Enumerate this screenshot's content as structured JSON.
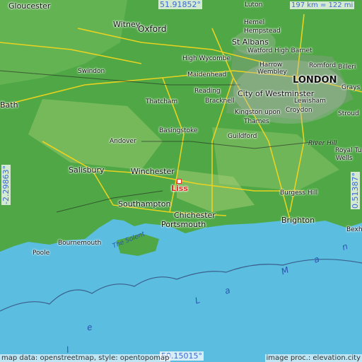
{
  "coordinates": {
    "north": "51.91852°",
    "south": "50.15015°",
    "west": "-2.29863°",
    "east": "0.51387°",
    "scale": "197 km = 122 mi"
  },
  "places": {
    "gloucester": "Gloucester",
    "luton": "Luton",
    "witney": "Witney",
    "oxford": "Oxford",
    "hemel": "Hemel",
    "hempstead": "Hempstead",
    "st_albans": "St Albans",
    "watford": "Watford",
    "high_barnet": "High Barnet",
    "high_wycombe": "High Wycombe",
    "harrow": "Harrow",
    "wembley": "Wembley",
    "romford": "Romford",
    "billericay": "Billeri",
    "maidenhead": "Maidenhead",
    "london": "LONDON",
    "swindon": "Swindon",
    "reading": "Reading",
    "city_westminster": "City of Westminster",
    "grays": "Grays",
    "bath": "Bath",
    "thatcham": "Thatcham",
    "bracknell": "Bracknell",
    "lewisham": "Lewisham",
    "croydon": "Croydon",
    "kingston": "Kingston upon",
    "thames": "Thames",
    "stroud": "Stroud",
    "basingstoke": "Basingstoke",
    "guildford": "Guildford",
    "andover": "Andover",
    "river_hill": "River Hill",
    "royal_tunbridge": "Royal Tu",
    "wells": "Wells",
    "salisbury": "Salisbury",
    "winchester": "Winchester",
    "liss": "Liss",
    "burgess_hill": "Burgess Hill",
    "southampton": "Southampton",
    "chichester": "Chichester",
    "portsmouth": "Portsmouth",
    "brighton": "Brighton",
    "bexhill": "Bexh",
    "bournemouth": "Bournemouth",
    "poole": "Poole",
    "the_solent": "The Solent"
  },
  "sea_letters": [
    "M",
    "a",
    "n",
    "L",
    "a",
    "e",
    "l"
  ],
  "footer": {
    "left": "map data: openstreetmap, style: opentopomap",
    "right": "image proc.: elevation.city"
  },
  "colors": {
    "sea": "#5bbde0",
    "land": "#4fa845",
    "highlight": "#e0302a",
    "coord_text": "#3a6ad8"
  }
}
